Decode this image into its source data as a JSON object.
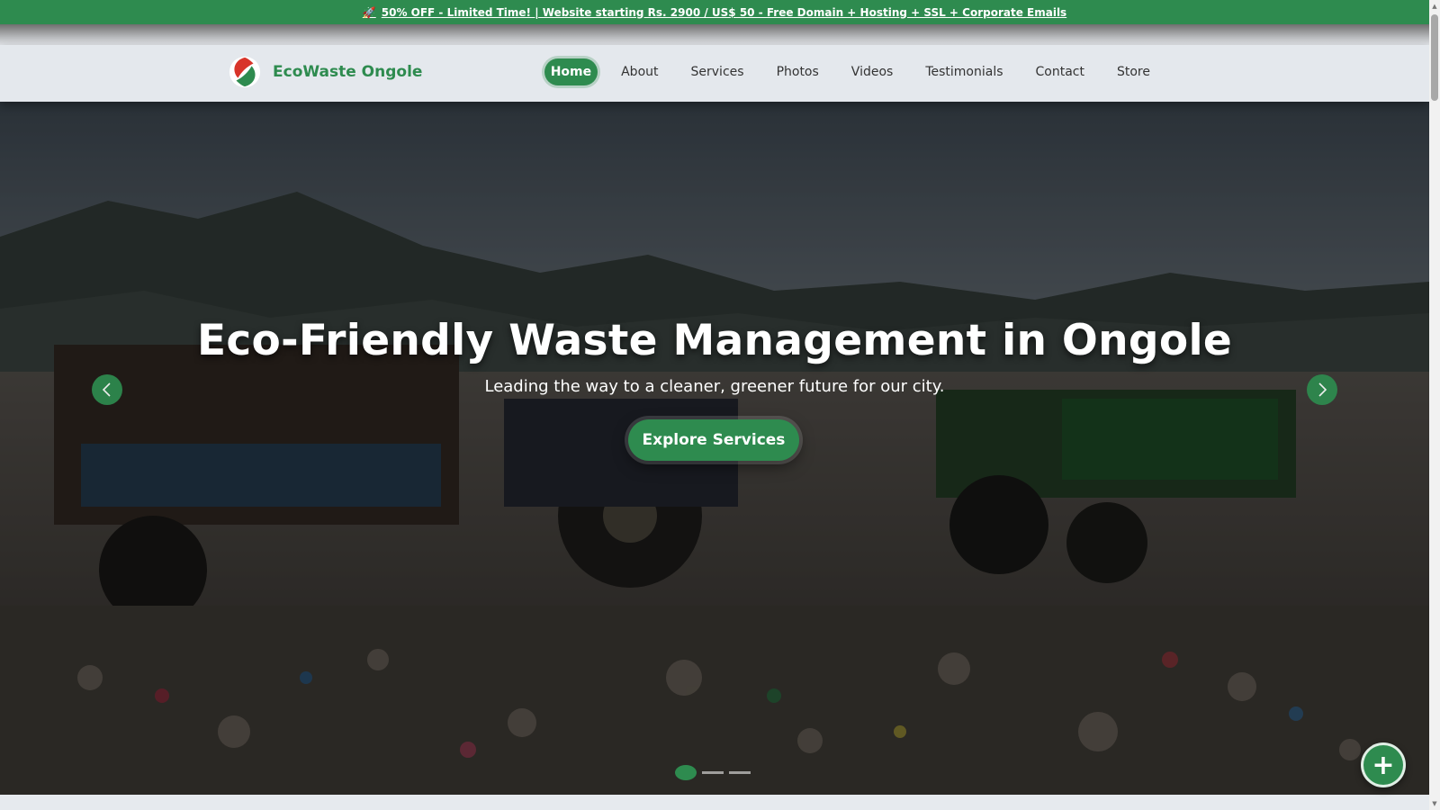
{
  "promo": {
    "icon": "rocket-icon",
    "text": "50% OFF - Limited Time! | Website starting Rs. 2900 / US$ 50 - Free Domain + Hosting + SSL + Corporate Emails"
  },
  "brand": {
    "name": "EcoWaste Ongole",
    "logo_icon": "leaf-logo-icon",
    "color": "#2e8b4f"
  },
  "nav": {
    "items": [
      {
        "label": "Home",
        "active": true
      },
      {
        "label": "About"
      },
      {
        "label": "Services"
      },
      {
        "label": "Photos"
      },
      {
        "label": "Videos"
      },
      {
        "label": "Testimonials"
      },
      {
        "label": "Contact"
      },
      {
        "label": "Store"
      }
    ]
  },
  "hero": {
    "title": "Eco-Friendly Waste Management in Ongole",
    "subtitle": "Leading the way to a cleaner, greener future for our city.",
    "cta_label": "Explore Services",
    "slides_total": 3,
    "active_slide": 1
  },
  "fab": {
    "symbol": "+"
  }
}
